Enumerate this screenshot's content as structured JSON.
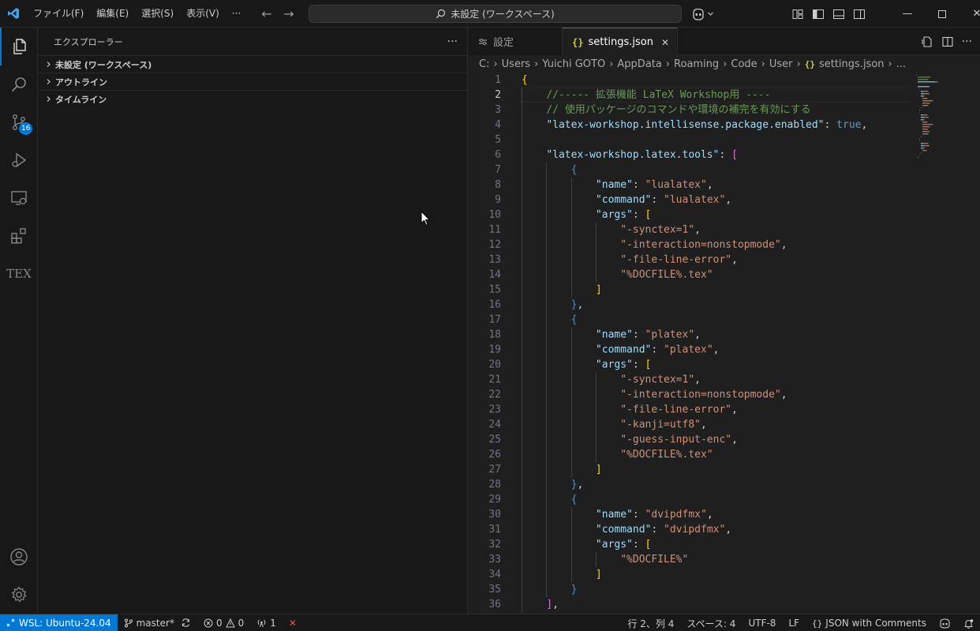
{
  "titlebar": {
    "menu": [
      "ファイル(F)",
      "編集(E)",
      "選択(S)",
      "表示(V)",
      "···"
    ],
    "search_text": "未設定 (ワークスペース)"
  },
  "activitybar": {
    "items": [
      "explorer-icon",
      "search-icon",
      "source-control-icon",
      "run-debug-icon",
      "remote-explorer-icon",
      "extensions-icon",
      "tex-icon"
    ],
    "scm_badge": "16",
    "tex_label": "TEX"
  },
  "sidebar": {
    "title": "エクスプローラー",
    "more": "···",
    "sections": [
      "未設定 (ワークスペース)",
      "アウトライン",
      "タイムライン"
    ]
  },
  "editor": {
    "tabs": [
      {
        "label": "設定",
        "icon": "settings-icon"
      },
      {
        "label": "settings.json",
        "icon": "json-braces-icon",
        "close": "✕"
      }
    ],
    "breadcrumb": [
      "C:",
      "Users",
      "Yuichi GOTO",
      "AppData",
      "Roaming",
      "Code",
      "User",
      "settings.json",
      "..."
    ],
    "current_line": 2,
    "lines": [
      {
        "n": "1"
      },
      {
        "n": "2"
      },
      {
        "n": "3"
      },
      {
        "n": "4"
      },
      {
        "n": "5"
      },
      {
        "n": "6"
      },
      {
        "n": "7"
      },
      {
        "n": "8"
      },
      {
        "n": "9"
      },
      {
        "n": "10"
      },
      {
        "n": "11"
      },
      {
        "n": "12"
      },
      {
        "n": "13"
      },
      {
        "n": "14"
      },
      {
        "n": "15"
      },
      {
        "n": "16"
      },
      {
        "n": "17"
      },
      {
        "n": "18"
      },
      {
        "n": "19"
      },
      {
        "n": "20"
      },
      {
        "n": "21"
      },
      {
        "n": "22"
      },
      {
        "n": "23"
      },
      {
        "n": "24"
      },
      {
        "n": "25"
      },
      {
        "n": "26"
      },
      {
        "n": "27"
      },
      {
        "n": "28"
      },
      {
        "n": "29"
      },
      {
        "n": "30"
      },
      {
        "n": "31"
      },
      {
        "n": "32"
      },
      {
        "n": "33"
      },
      {
        "n": "34"
      },
      {
        "n": "35"
      },
      {
        "n": "36"
      }
    ],
    "code": {
      "l1_open": "{",
      "l2_comment": "//----- 拡張機能 LaTeX Workshop用 ----",
      "l3_comment": "// 使用パッケージのコマンドや環境の補完を有効にする",
      "l4_key": "\"latex-workshop.intellisense.package.enabled\"",
      "l4_val": "true",
      "l6_key": "\"latex-workshop.latex.tools\"",
      "tools": [
        {
          "name": "\"lualatex\"",
          "command": "\"lualatex\"",
          "args": [
            "\"-synctex=1\"",
            "\"-interaction=nonstopmode\"",
            "\"-file-line-error\"",
            "\"%DOCFILE%.tex\""
          ]
        },
        {
          "name": "\"platex\"",
          "command": "\"platex\"",
          "args": [
            "\"-synctex=1\"",
            "\"-interaction=nonstopmode\"",
            "\"-file-line-error\"",
            "\"-kanji=utf8\"",
            "\"-guess-input-enc\"",
            "\"%DOCFILE%.tex\""
          ]
        },
        {
          "name": "\"dvipdfmx\"",
          "command": "\"dvipdfmx\"",
          "args": [
            "\"%DOCFILE%\""
          ]
        }
      ],
      "name_key": "\"name\"",
      "command_key": "\"command\"",
      "args_key": "\"args\""
    }
  },
  "statusbar": {
    "remote": "WSL: Ubuntu-24.04",
    "branch": "master*",
    "errors": "0",
    "warnings": "0",
    "ports": "1",
    "cursor_pos": "行 2、列 4",
    "spaces": "スペース: 4",
    "encoding": "UTF-8",
    "eol": "LF",
    "language": "JSON with Comments"
  }
}
